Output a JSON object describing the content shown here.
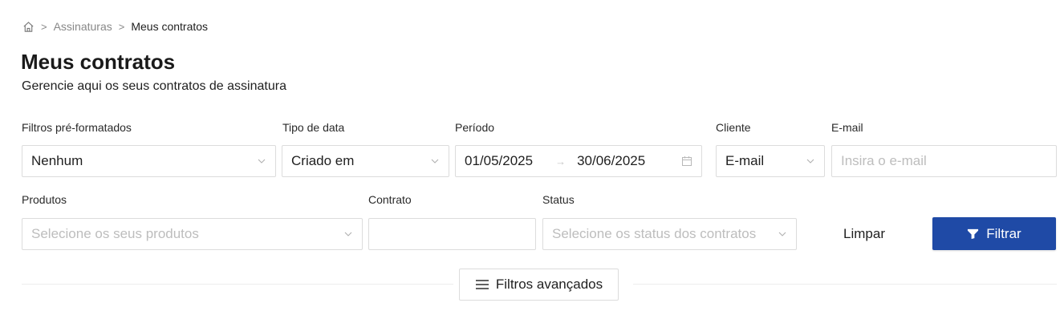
{
  "breadcrumb": {
    "home_icon": "home-icon",
    "separator": ">",
    "items": [
      "Assinaturas",
      "Meus contratos"
    ]
  },
  "page": {
    "title": "Meus contratos",
    "subtitle": "Gerencie aqui os seus contratos de assinatura"
  },
  "filters": {
    "preset": {
      "label": "Filtros pré-formatados",
      "value": "Nenhum"
    },
    "date_type": {
      "label": "Tipo de data",
      "value": "Criado em"
    },
    "period": {
      "label": "Período",
      "start": "01/05/2025",
      "arrow": "→",
      "end": "30/06/2025",
      "icon": "calendar-icon"
    },
    "client": {
      "label": "Cliente",
      "value": "E-mail"
    },
    "email": {
      "label": "E-mail",
      "placeholder": "Insira o e-mail",
      "value": ""
    },
    "products": {
      "label": "Produtos",
      "placeholder": "Selecione os seus produtos"
    },
    "contract": {
      "label": "Contrato",
      "value": ""
    },
    "status": {
      "label": "Status",
      "placeholder": "Selecione os status dos contratos"
    }
  },
  "actions": {
    "clear_label": "Limpar",
    "filter_label": "Filtrar",
    "filter_icon": "funnel-icon",
    "advanced_label": "Filtros avançados",
    "advanced_icon": "menu-icon"
  },
  "colors": {
    "primary": "#1f4aa6",
    "border": "#dcdcdc",
    "placeholder": "#bdbdbd"
  }
}
